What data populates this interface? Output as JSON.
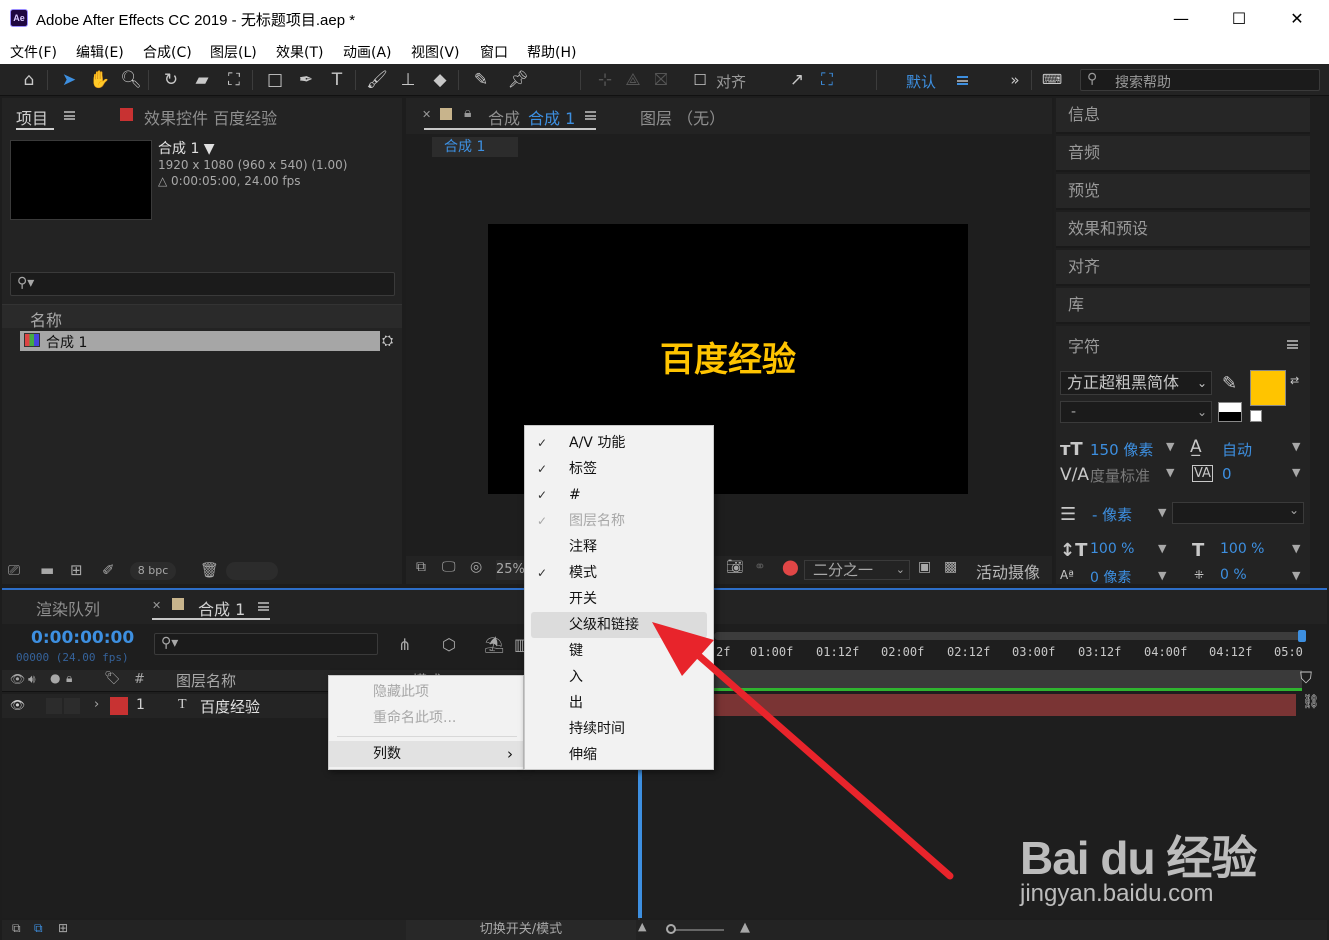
{
  "window": {
    "title": "Adobe After Effects CC 2019 - 无标题项目.aep *",
    "app_icon": "Ae",
    "minimize": "—",
    "maximize": "☐",
    "close": "✕"
  },
  "menu": [
    "文件(F)",
    "编辑(E)",
    "合成(C)",
    "图层(L)",
    "效果(T)",
    "动画(A)",
    "视图(V)",
    "窗口",
    "帮助(H)"
  ],
  "toolbar": {
    "align_label": "对齐",
    "workspace": "默认",
    "search_placeholder": "搜索帮助"
  },
  "project_panel": {
    "tab_project": "项目",
    "tab_effects": "效果控件 百度经验",
    "comp_name": "合成  1 ▼",
    "comp_info1": "1920 x 1080  (960 x 540) (1.00)",
    "comp_info2": "△ 0:00:05:00, 24.00 fps",
    "col_name": "名称",
    "item_name": "合成  1",
    "bpc": "8 bpc"
  },
  "comp_panel": {
    "tab_prefix": "合成",
    "tab_name": "合成 1",
    "layer_tab": "图层  （无）",
    "sub_tab": "合成 1",
    "canvas_text": "百度经验",
    "zoom": "25%",
    "resolution": "二分之一",
    "camera": "活动摄像"
  },
  "right_panels": {
    "items": [
      "信息",
      "音频",
      "预览",
      "效果和预设",
      "对齐",
      "库"
    ],
    "char_title": "字符"
  },
  "character": {
    "font": "方正超粗黑简体",
    "style": "-",
    "size": "150 像素",
    "leading": "自动",
    "kerning": "度量标准",
    "tracking": "0",
    "stroke": "- 像素",
    "vscale": "100 %",
    "hscale": "100 %",
    "baseline": "0 像素",
    "tsume": "0 %",
    "fill_color": "#ffc400"
  },
  "timeline": {
    "tab_render": "渲染队列",
    "tab_comp": "合成 1",
    "timecode": "0:00:00:00",
    "frames": "00000 (24.00 fps)",
    "col_num": "#",
    "col_layer": "图层名称",
    "col_mode": "模式",
    "layer_num": "1",
    "layer_type": "T",
    "layer_name": "百度经验",
    "ruler": [
      "2f",
      "01:00f",
      "01:12f",
      "02:00f",
      "02:12f",
      "03:00f",
      "03:12f",
      "04:00f",
      "04:12f",
      "05:0"
    ],
    "bottom_toggle": "切换开关/模式"
  },
  "context_menu_left": {
    "items": [
      "隐藏此项",
      "重命名此项...",
      "列数"
    ]
  },
  "context_menu_right": {
    "items": [
      {
        "label": "A/V 功能",
        "checked": "✓"
      },
      {
        "label": "标签",
        "checked": "✓"
      },
      {
        "label": "#",
        "checked": "✓"
      },
      {
        "label": "图层名称",
        "checked": "✓"
      },
      {
        "label": "注释",
        "checked": ""
      },
      {
        "label": "模式",
        "checked": "✓"
      },
      {
        "label": "开关",
        "checked": ""
      },
      {
        "label": "父级和链接",
        "checked": ""
      },
      {
        "label": "键",
        "checked": ""
      },
      {
        "label": "入",
        "checked": ""
      },
      {
        "label": "出",
        "checked": ""
      },
      {
        "label": "持续时间",
        "checked": ""
      },
      {
        "label": "伸缩",
        "checked": ""
      }
    ]
  },
  "watermark": {
    "brand": "Bai du 经验",
    "url": "jingyan.baidu.com"
  },
  "colors": {
    "accent": "#3d8fe0",
    "arrow": "#e8242b",
    "layer_bar": "#7a3434",
    "label_red": "#c83232"
  }
}
